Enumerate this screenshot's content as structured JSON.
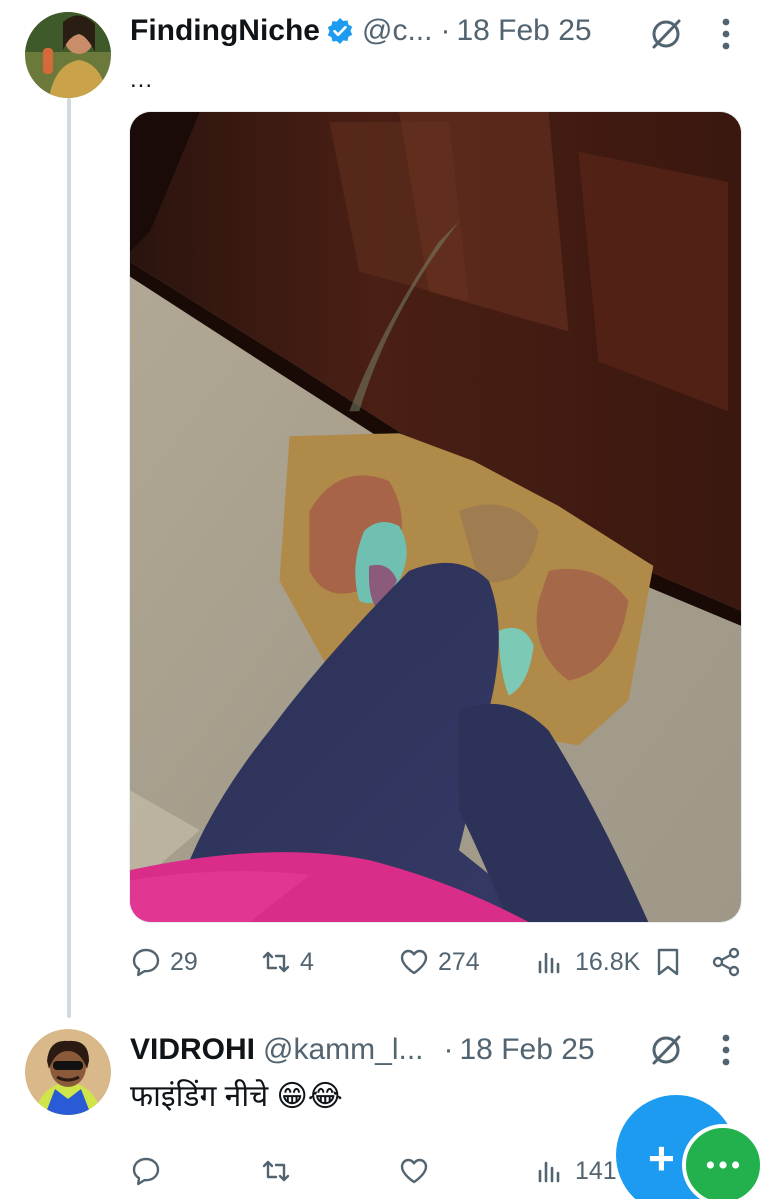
{
  "tweet1": {
    "name": "FindingNiche",
    "handle": "@c...",
    "separator": "·",
    "date": "18 Feb 25",
    "text": "...",
    "avatar_icon": "user-avatar",
    "verified_icon": "verified-badge-icon",
    "stats": {
      "replies": "29",
      "reposts": "4",
      "likes": "274",
      "views": "16.8K"
    }
  },
  "tweet2": {
    "name": "VIDROHI",
    "handle": "@kamm_l...",
    "separator": "·",
    "date": "18 Feb 25",
    "text": "फाइंडिंग नीचे 😁😂",
    "avatar_icon": "user-avatar",
    "stats": {
      "views": "141"
    }
  },
  "colors": {
    "accent": "#1d9bf0",
    "secondary_text": "#536471",
    "thread_line": "#cfd9de",
    "fab_secondary": "#22b14c"
  }
}
